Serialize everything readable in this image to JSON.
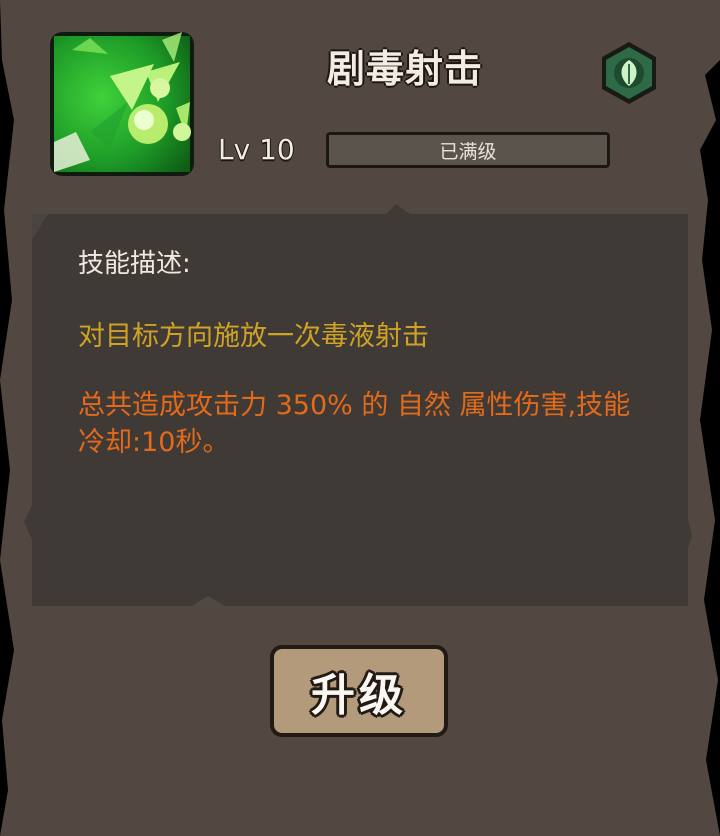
{
  "skill": {
    "name": "剧毒射击",
    "element_icon": "nature-leaf-icon",
    "icon": "poison-shot-icon"
  },
  "level": {
    "label": "Lv 10",
    "status_text": "已满级",
    "progress": 1.0
  },
  "description": {
    "heading": "技能描述:",
    "line1": "对目标方向施放一次毒液射击",
    "line2": "总共造成攻击力 350% 的 自然 属性伤害,技能冷却:10秒。"
  },
  "buttons": {
    "upgrade_label": "升级"
  },
  "colors": {
    "panel": "#524740",
    "inner_panel": "#3f3a36",
    "description_gold": "#cfa226",
    "description_orange": "#e36a1a",
    "element_green": "#2f6a47",
    "button": "#b39a7b"
  }
}
